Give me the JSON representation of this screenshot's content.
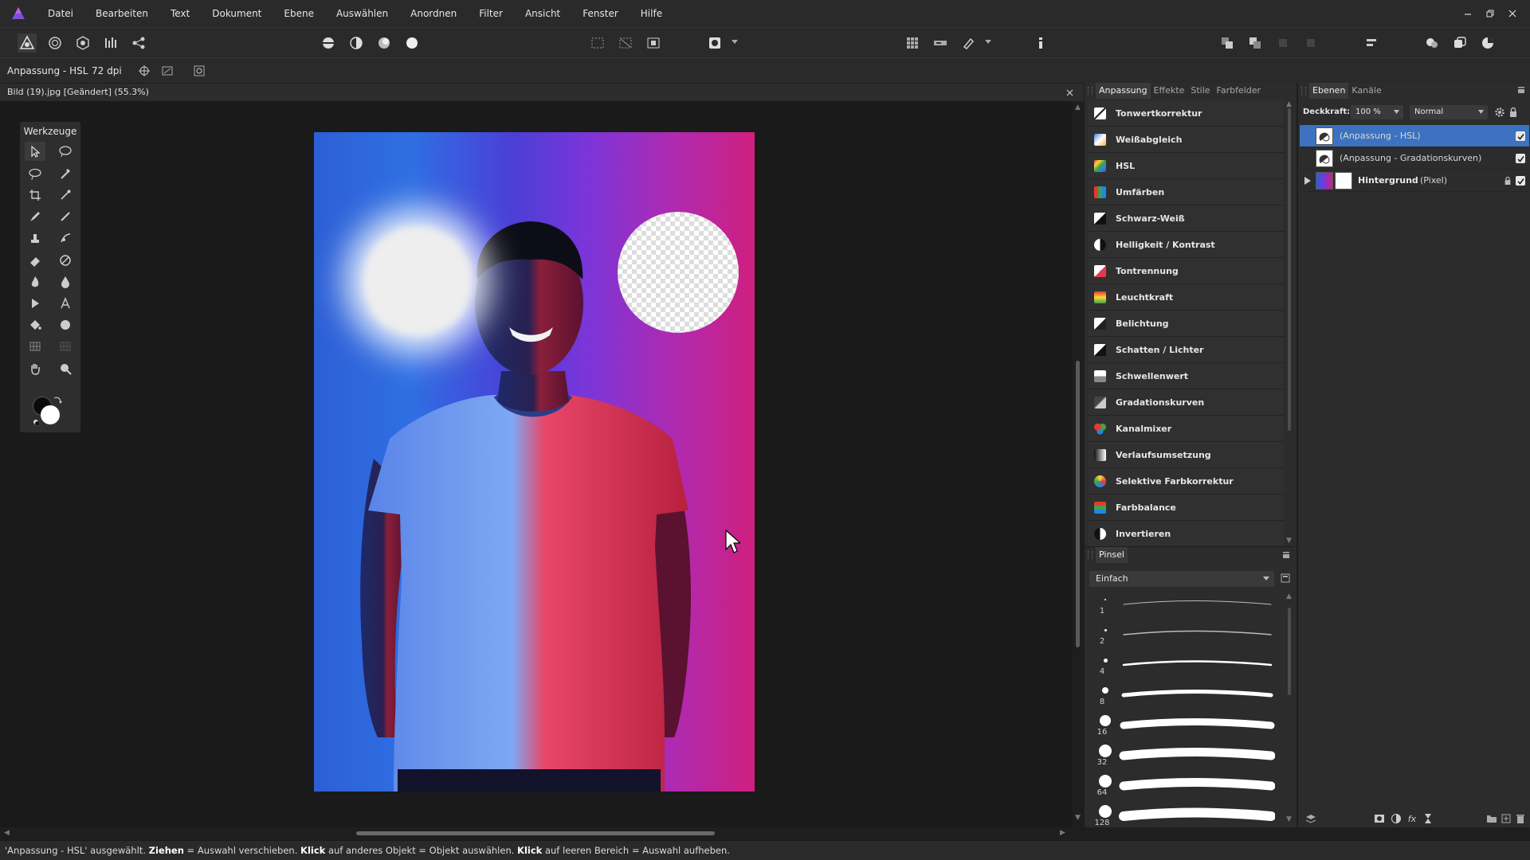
{
  "app": {
    "accent": "#3c72c0",
    "name": "Affinity Photo"
  },
  "menu": {
    "items": [
      "Datei",
      "Bearbeiten",
      "Text",
      "Dokument",
      "Ebene",
      "Auswählen",
      "Anordnen",
      "Filter",
      "Ansicht",
      "Fenster",
      "Hilfe"
    ]
  },
  "context": {
    "tool_name": "Anpassung - HSL",
    "dpi": "72 dpi"
  },
  "document": {
    "title": "Bild (19).jpg [Geändert] (55.3%)"
  },
  "tools_panel": {
    "title": "Werkzeuge"
  },
  "adjustments": {
    "tabs": [
      "Anpassung",
      "Effekte",
      "Stile",
      "Farbfelder"
    ],
    "items": [
      {
        "label": "Tonwertkorrektur",
        "icon": "levels-icon"
      },
      {
        "label": "Weißabgleich",
        "icon": "white-balance-icon"
      },
      {
        "label": "HSL",
        "icon": "hsl-icon"
      },
      {
        "label": "Umfärben",
        "icon": "recolor-icon"
      },
      {
        "label": "Schwarz-Weiß",
        "icon": "black-white-icon"
      },
      {
        "label": "Helligkeit / Kontrast",
        "icon": "brightness-contrast-icon"
      },
      {
        "label": "Tontrennung",
        "icon": "posterize-icon"
      },
      {
        "label": "Leuchtkraft",
        "icon": "vibrance-icon"
      },
      {
        "label": "Belichtung",
        "icon": "exposure-icon"
      },
      {
        "label": "Schatten / Lichter",
        "icon": "shadows-highlights-icon"
      },
      {
        "label": "Schwellenwert",
        "icon": "threshold-icon"
      },
      {
        "label": "Gradationskurven",
        "icon": "curves-icon"
      },
      {
        "label": "Kanalmixer",
        "icon": "channel-mixer-icon"
      },
      {
        "label": "Verlaufsumsetzung",
        "icon": "gradient-map-icon"
      },
      {
        "label": "Selektive Farbkorrektur",
        "icon": "selective-color-icon"
      },
      {
        "label": "Farbbalance",
        "icon": "color-balance-icon"
      },
      {
        "label": "Invertieren",
        "icon": "invert-icon"
      }
    ]
  },
  "brushes": {
    "tab": "Pinsel",
    "category": "Einfach",
    "sizes": [
      "1",
      "2",
      "4",
      "8",
      "16",
      "32",
      "64",
      "128"
    ]
  },
  "layers": {
    "tabs": [
      "Ebenen",
      "Kanäle"
    ],
    "opacity_label": "Deckkraft:",
    "opacity_value": "100 %",
    "blend_mode": "Normal",
    "items": [
      {
        "name": "(Anpassung - HSL)",
        "selected": true
      },
      {
        "name": "(Anpassung - Gradationskurven)",
        "selected": false
      },
      {
        "name": "Hintergrund",
        "suffix": "(Pixel)",
        "selected": false
      }
    ]
  },
  "status": {
    "p1": "'Anpassung - HSL' ausgewählt. ",
    "k1": "Ziehen",
    "p2": " = Auswahl verschieben. ",
    "k2": "Klick",
    "p3": " auf anderes Objekt = Objekt auswählen. ",
    "k3": "Klick",
    "p4": " auf leeren Bereich = Auswahl aufheben."
  }
}
